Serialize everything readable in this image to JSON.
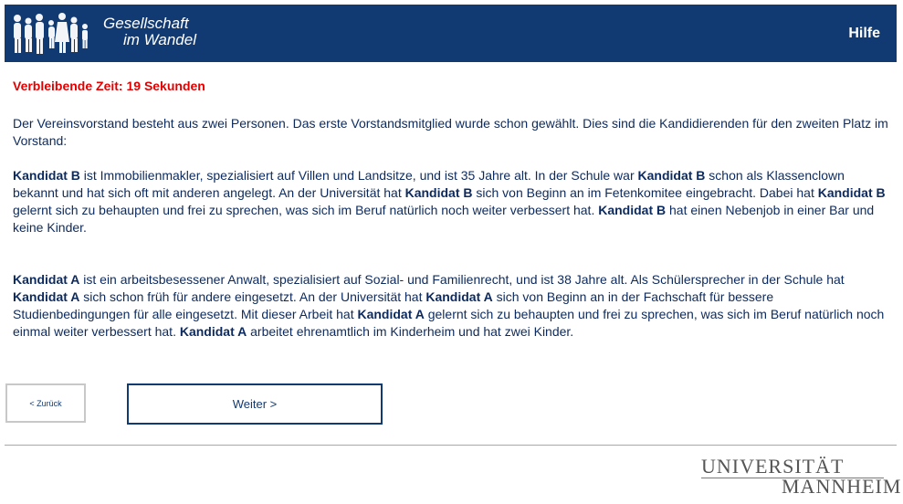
{
  "header": {
    "logo_line1": "Gesellschaft",
    "logo_line2": "im Wandel",
    "help_label": "Hilfe",
    "background_color": "#123a72"
  },
  "timer": {
    "text": "Verbleibende Zeit: 19 Sekunden",
    "color": "#e30000"
  },
  "content": {
    "intro": "Der Vereinsvorstand besteht aus zwei Personen. Das erste Vorstandsmitglied wurde schon gewählt. Dies sind die Kandidierenden für den zweiten Platz im Vorstand:",
    "candidate_b": {
      "name": "Kandidat B",
      "t1": " ist Immobilienmakler, spezialisiert auf Villen und Landsitze, und ist 35 Jahre alt. In der Schule war ",
      "t2": " schon als Klassenclown bekannt und hat sich oft mit anderen angelegt. An der Universität hat ",
      "t3": " sich von Beginn an im Fetenkomitee eingebracht. Dabei hat ",
      "t4": " gelernt sich zu behaupten und frei zu sprechen, was sich im Beruf natürlich noch weiter verbessert hat. ",
      "t5": " hat einen Nebenjob in einer Bar und keine Kinder."
    },
    "candidate_a": {
      "name": "Kandidat A",
      "t1": " ist ein arbeitsbesessener Anwalt, spezialisiert auf Sozial- und Familienrecht, und ist 38 Jahre alt. Als Schülersprecher in der Schule hat ",
      "t2": " sich schon früh für andere eingesetzt. An der Universität hat ",
      "t3": " sich von Beginn an in der Fachschaft für bessere Studienbedingungen für alle eingesetzt. Mit dieser Arbeit hat ",
      "t4": " gelernt sich zu behaupten und frei zu sprechen, was sich im Beruf natürlich noch einmal weiter verbessert hat. ",
      "t5": " arbeitet ehrenamtlich im Kinderheim und hat zwei Kinder."
    }
  },
  "nav": {
    "back_label": "< Zurück",
    "next_label": "Weiter >"
  },
  "footer": {
    "logo_line1": "UNIVERSITÄT",
    "logo_line2": "MANNHEIM"
  }
}
